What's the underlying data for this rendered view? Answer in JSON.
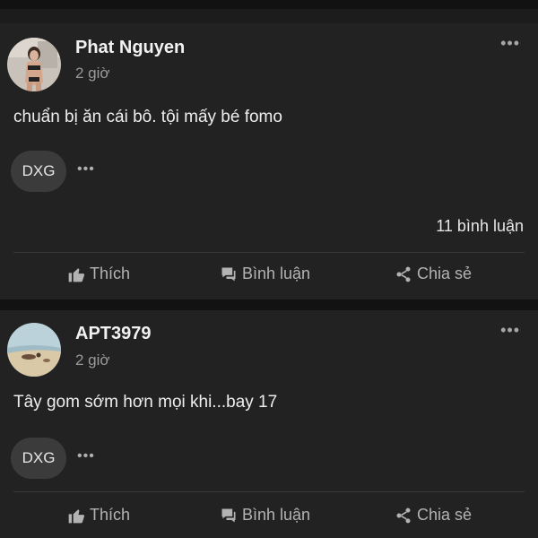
{
  "posts": [
    {
      "author": "Phat Nguyen",
      "time": "2 giờ",
      "content": "chuẩn bị ăn cái bô. tội mấy bé fomo",
      "tag": "DXG",
      "tag_more": "•••",
      "more": "•••",
      "comments_count": "11 bình luận",
      "actions": {
        "like": "Thích",
        "comment": "Bình luận",
        "share": "Chia sẻ"
      }
    },
    {
      "author": "APT3979",
      "time": "2 giờ",
      "content": "Tây gom sớm hơn mọi khi...bay 17",
      "tag": "DXG",
      "tag_more": "•••",
      "more": "•••",
      "actions": {
        "like": "Thích",
        "comment": "Bình luận",
        "share": "Chia sẻ"
      }
    }
  ],
  "icons": {
    "like": "thumbs-up-icon",
    "comment": "comment-icon",
    "share": "share-icon",
    "more": "more-horizontal-icon"
  },
  "colors": {
    "background": "#141414",
    "card": "#222222",
    "text": "#eeeeee",
    "muted": "#9a9a9a",
    "tag_bg": "#3b3b3b"
  }
}
